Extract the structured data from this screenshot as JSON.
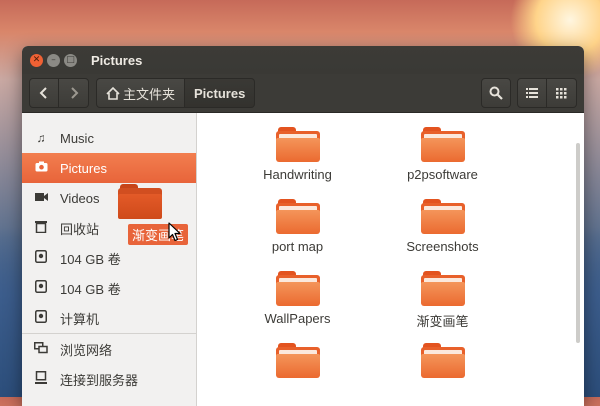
{
  "window": {
    "title": "Pictures"
  },
  "toolbar": {
    "path": [
      {
        "label": "主文件夹",
        "icon": "home-icon"
      },
      {
        "label": "Pictures"
      }
    ]
  },
  "sidebar": {
    "items": [
      {
        "label": "Music",
        "icon": "music-icon"
      },
      {
        "label": "Pictures",
        "icon": "camera-icon",
        "active": true
      },
      {
        "label": "Videos",
        "icon": "video-icon"
      },
      {
        "label": "回收站",
        "icon": "trash-icon"
      },
      {
        "label": "104 GB 卷",
        "icon": "drive-icon"
      },
      {
        "label": "104 GB 卷",
        "icon": "drive-icon"
      },
      {
        "label": "计算机",
        "icon": "computer-icon"
      },
      {
        "label": "浏览网络",
        "icon": "network-icon"
      },
      {
        "label": "连接到服务器",
        "icon": "server-icon"
      }
    ]
  },
  "files": [
    {
      "name": "Handwriting"
    },
    {
      "name": "p2psoftware"
    },
    {
      "name": "port map"
    },
    {
      "name": "Screenshots"
    },
    {
      "name": "WallPapers"
    },
    {
      "name": "渐变画笔"
    },
    {
      "name": ""
    },
    {
      "name": ""
    }
  ],
  "drag": {
    "label": "渐变画笔"
  },
  "colors": {
    "accent": "#e8643a",
    "folder": "#eb6a30",
    "titlebar": "#3c3b37"
  }
}
